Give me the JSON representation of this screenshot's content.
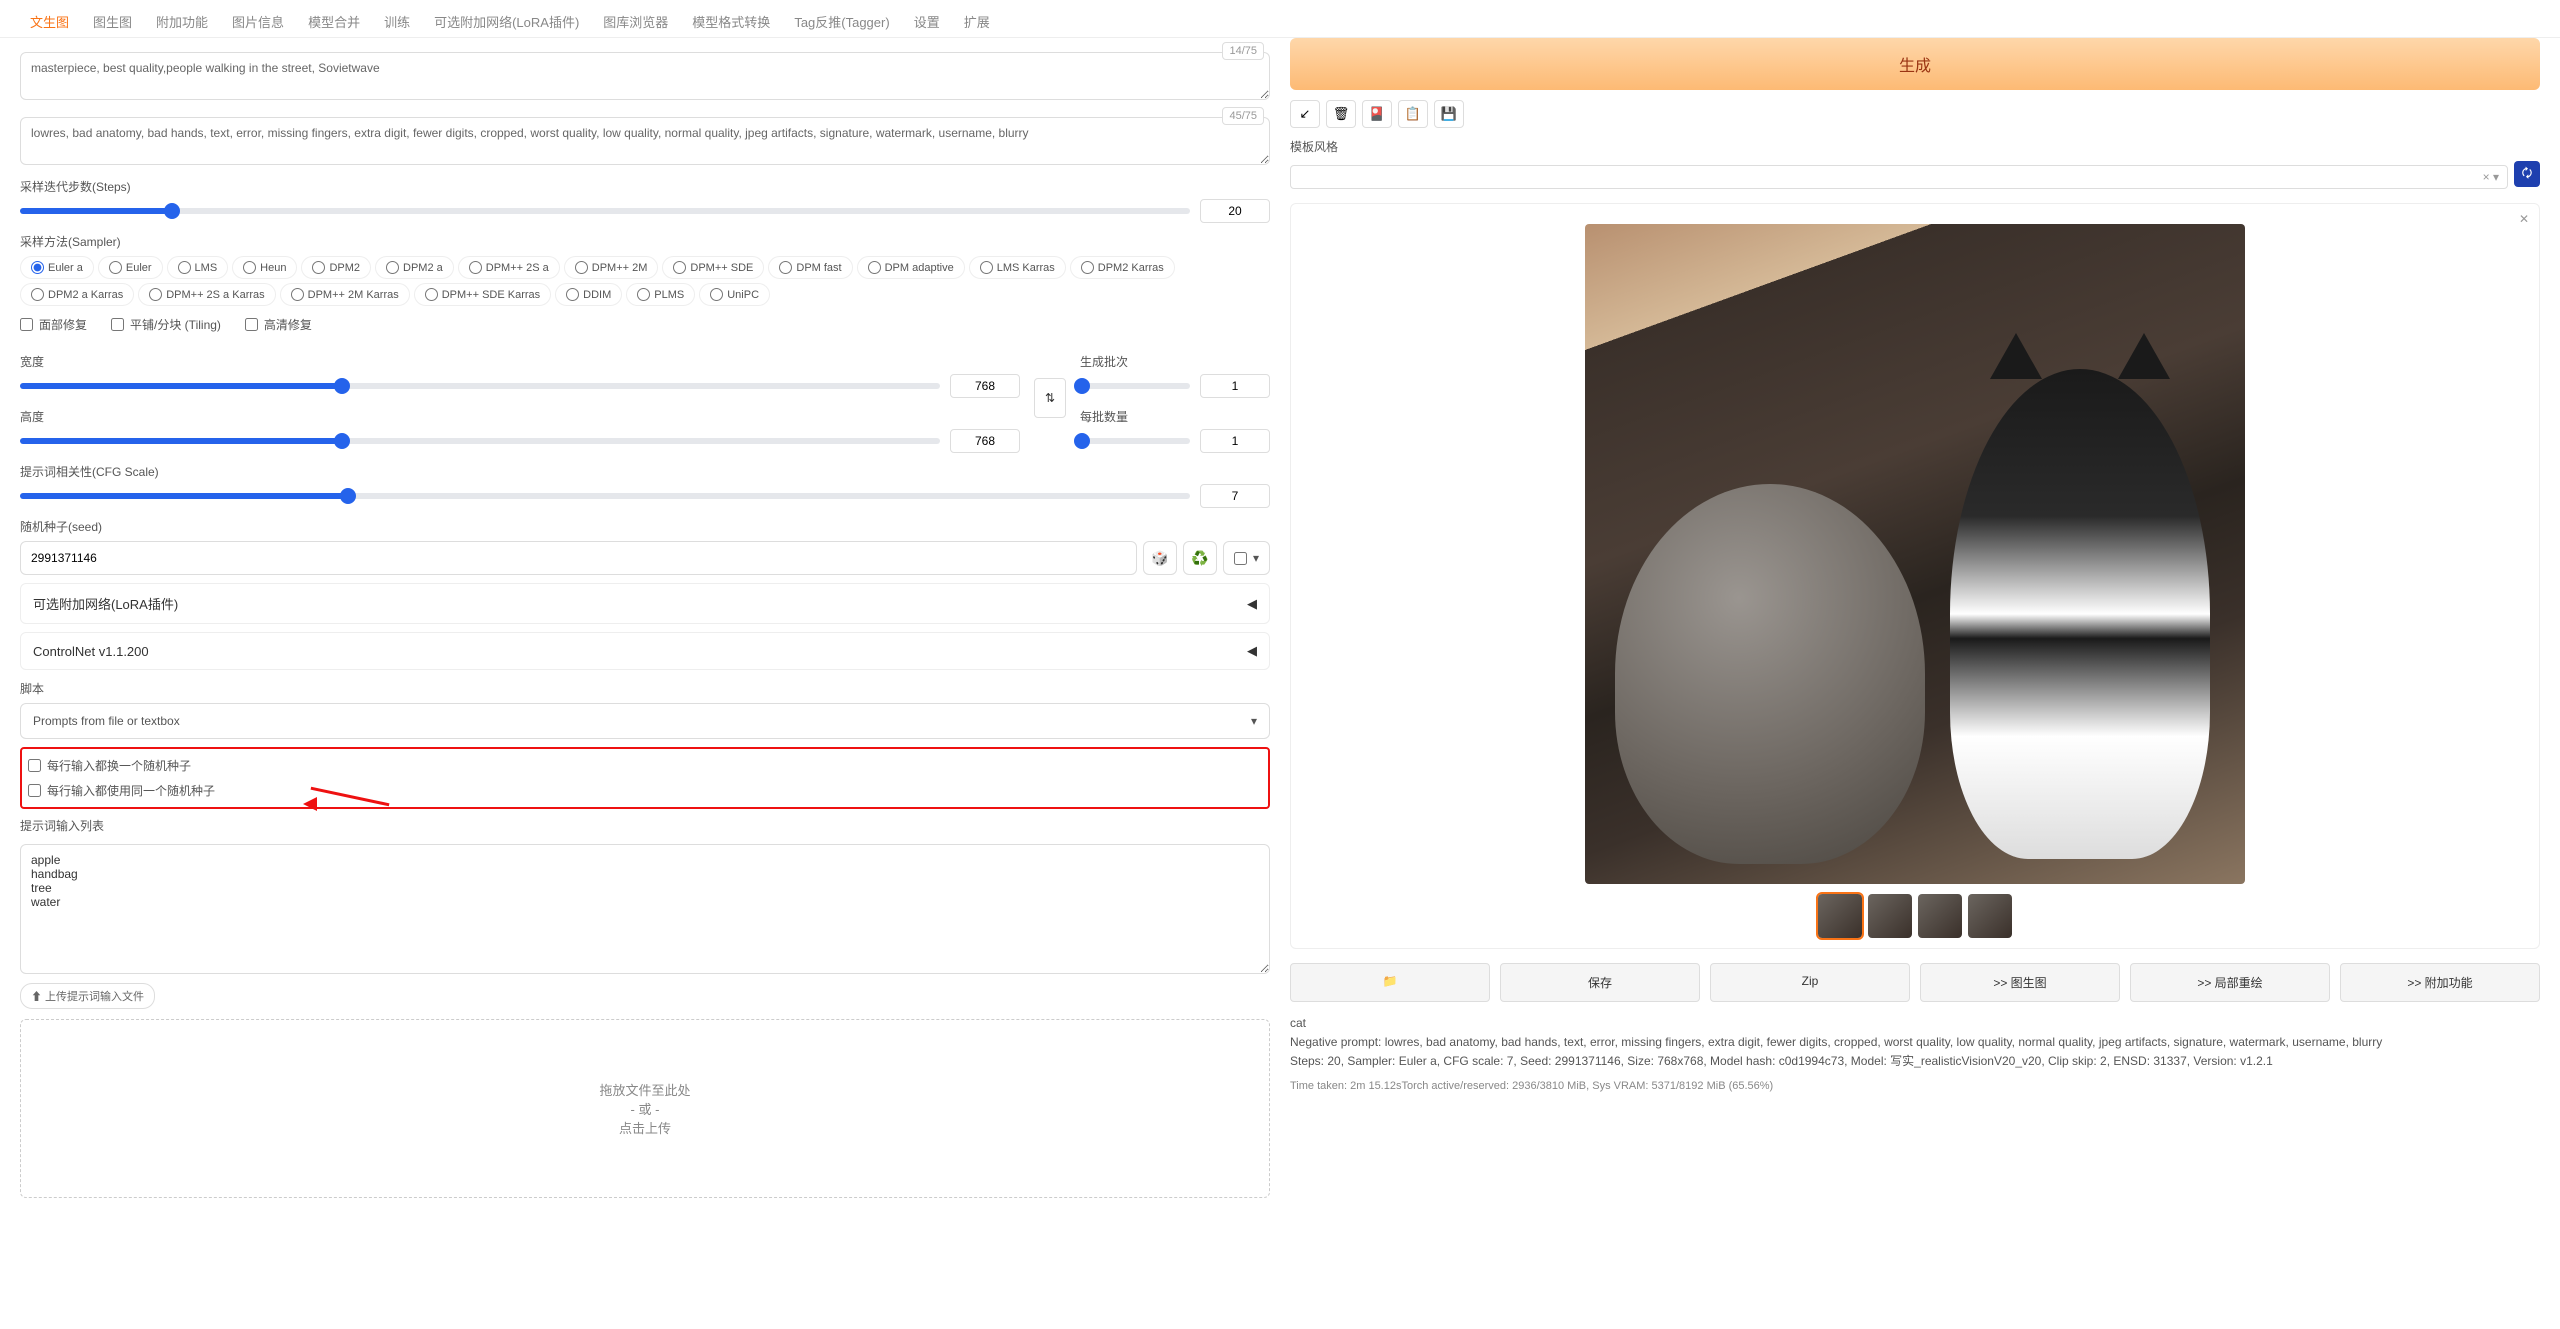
{
  "tabs": [
    "文生图",
    "图生图",
    "附加功能",
    "图片信息",
    "模型合并",
    "训练",
    "可选附加网络(LoRA插件)",
    "图库浏览器",
    "模型格式转换",
    "Tag反推(Tagger)",
    "设置",
    "扩展"
  ],
  "prompt": {
    "text": "masterpiece, best quality,people walking in the street, Sovietwave",
    "tokens": "14/75"
  },
  "neg": {
    "text": "lowres, bad anatomy, bad hands, text, error, missing fingers, extra digit, fewer digits, cropped, worst quality, low quality, normal quality, jpeg artifacts, signature, watermark, username, blurry",
    "tokens": "45/75"
  },
  "steps": {
    "label": "采样迭代步数(Steps)",
    "val": "20",
    "pct": 13
  },
  "sampler": {
    "label": "采样方法(Sampler)",
    "opts": [
      "Euler a",
      "Euler",
      "LMS",
      "Heun",
      "DPM2",
      "DPM2 a",
      "DPM++ 2S a",
      "DPM++ 2M",
      "DPM++ SDE",
      "DPM fast",
      "DPM adaptive",
      "LMS Karras",
      "DPM2 Karras",
      "DPM2 a Karras",
      "DPM++ 2S a Karras",
      "DPM++ 2M Karras",
      "DPM++ SDE Karras",
      "DDIM",
      "PLMS",
      "UniPC"
    ],
    "sel": "Euler a"
  },
  "checks": {
    "face": "面部修复",
    "tile": "平铺/分块 (Tiling)",
    "hires": "高清修复"
  },
  "width": {
    "label": "宽度",
    "val": "768",
    "pct": 35
  },
  "height": {
    "label": "高度",
    "val": "768",
    "pct": 35
  },
  "batch_count": {
    "label": "生成批次",
    "val": "1",
    "pct": 2
  },
  "batch_size": {
    "label": "每批数量",
    "val": "1",
    "pct": 2
  },
  "cfg": {
    "label": "提示词相关性(CFG Scale)",
    "val": "7",
    "pct": 28
  },
  "seed": {
    "label": "随机种子(seed)",
    "val": "2991371146",
    "dice": "🎲",
    "recycle": "♻️"
  },
  "acc1": "可选附加网络(LoRA插件)",
  "acc2": "ControlNet v1.1.200",
  "script": {
    "label": "脚本",
    "sel": "Prompts from file or textbox"
  },
  "boxed": {
    "c1": "每行输入都换一个随机种子",
    "c2": "每行输入都使用同一个随机种子"
  },
  "plist": {
    "label": "提示词输入列表",
    "val": "apple\nhandbag\ntree\nwater"
  },
  "upload_btn": "⬆ 上传提示词输入文件",
  "drop": {
    "l1": "拖放文件至此处",
    "l2": "- 或 -",
    "l3": "点击上传"
  },
  "gen": "生成",
  "style_label": "模板风格",
  "out_btns": {
    "folder": "📁",
    "save": "保存",
    "zip": "Zip",
    "i2i": ">> 图生图",
    "inpaint": ">> 局部重绘",
    "extras": ">> 附加功能"
  },
  "meta": {
    "p": "cat",
    "np": "Negative prompt: lowres, bad anatomy, bad hands, text, error, missing fingers, extra digit, fewer digits, cropped, worst quality, low quality, normal quality, jpeg artifacts, signature, watermark, username, blurry",
    "params": "Steps: 20, Sampler: Euler a, CFG scale: 7, Seed: 2991371146, Size: 768x768, Model hash: c0d1994c73, Model: 写实_realisticVisionV20_v20, Clip skip: 2, ENSD: 31337, Version: v1.2.1",
    "time": "Time taken: 2m 15.12sTorch active/reserved: 2936/3810 MiB, Sys VRAM: 5371/8192 MiB (65.56%)"
  }
}
